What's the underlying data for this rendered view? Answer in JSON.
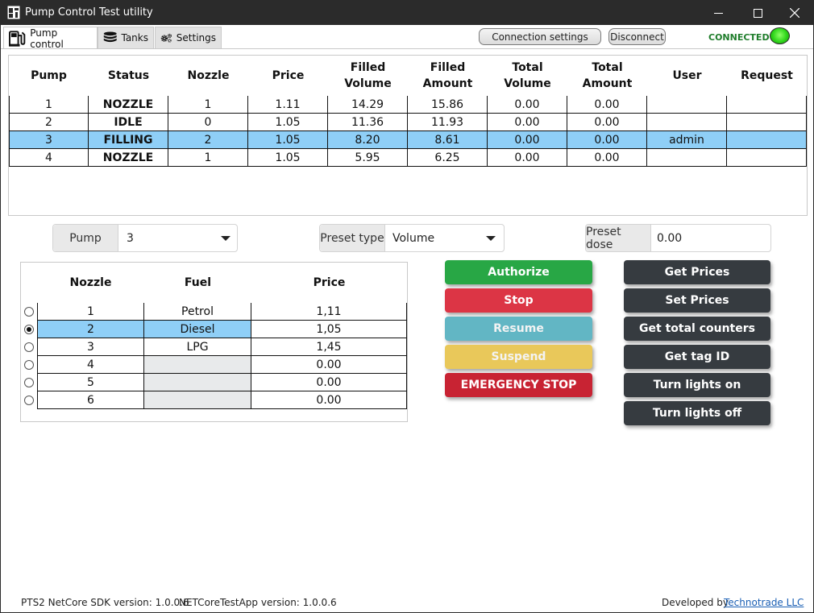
{
  "window": {
    "title": "Pump Control Test utility"
  },
  "tabs": [
    {
      "label": "Pump control",
      "icon": "fuel-pump-icon"
    },
    {
      "label": "Tanks",
      "icon": "database-icon"
    },
    {
      "label": "Settings",
      "icon": "gears-icon"
    }
  ],
  "toolbar": {
    "connection_settings_label": "Connection settings",
    "disconnect_label": "Disconnect",
    "status_label": "CONNECTED",
    "status_color": "#2ed51a"
  },
  "pump_table": {
    "columns": [
      "Pump",
      "Status",
      "Nozzle",
      "Price",
      "Filled Volume",
      "Filled Amount",
      "Total Volume",
      "Total Amount",
      "User",
      "Request"
    ],
    "rows": [
      [
        "1",
        "NOZZLE",
        "1",
        "1.11",
        "14.29",
        "15.86",
        "0.00",
        "0.00",
        "",
        ""
      ],
      [
        "2",
        "IDLE",
        "0",
        "1.05",
        "11.36",
        "11.93",
        "0.00",
        "0.00",
        "",
        ""
      ],
      [
        "3",
        "FILLING",
        "2",
        "1.05",
        "8.20",
        "8.61",
        "0.00",
        "0.00",
        "admin",
        ""
      ],
      [
        "4",
        "NOZZLE",
        "1",
        "1.05",
        "5.95",
        "6.25",
        "0.00",
        "0.00",
        "",
        ""
      ]
    ],
    "selected_row": 2
  },
  "pump_select": {
    "label": "Pump",
    "value": "3"
  },
  "preset_type": {
    "label": "Preset type",
    "value": "Volume"
  },
  "preset_dose": {
    "label": "Preset dose",
    "value": "0.00"
  },
  "nozzle_table": {
    "columns": [
      "Nozzle",
      "Fuel",
      "Price"
    ],
    "rows": [
      [
        "1",
        "Petrol",
        "1,11"
      ],
      [
        "2",
        "Diesel",
        "1,05"
      ],
      [
        "3",
        "LPG",
        "1,45"
      ],
      [
        "4",
        "",
        "0.00"
      ],
      [
        "5",
        "",
        "0.00"
      ],
      [
        "6",
        "",
        "0.00"
      ]
    ],
    "selected_row": 1
  },
  "actions": {
    "authorize": "Authorize",
    "stop": "Stop",
    "resume": "Resume",
    "suspend": "Suspend",
    "emergency_stop": "EMERGENCY STOP",
    "get_prices": "Get Prices",
    "set_prices": "Set Prices",
    "get_total_counters": "Get total counters",
    "get_tag_id": "Get tag ID",
    "turn_lights_on": "Turn lights on",
    "turn_lights_off": "Turn lights off"
  },
  "colors": {
    "authorize": "#28a745",
    "stop": "#dc3545",
    "resume": "#62b6c4",
    "suspend": "#e9c85a",
    "emergency": "#c82333",
    "dark": "#363b40",
    "selection": "#8fcff7"
  },
  "statusbar": {
    "sdk_version": "PTS2 NetCore SDK version: 1.0.0.6",
    "app_version": "NETCoreTestApp version: 1.0.0.6",
    "developed_by": "Developed by",
    "developer_link": "Technotrade LLC"
  }
}
